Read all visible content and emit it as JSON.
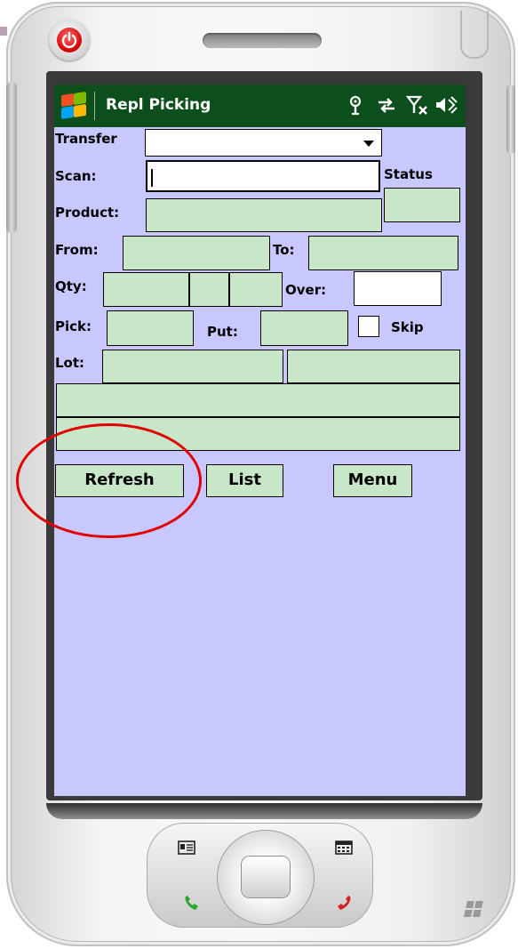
{
  "window": {
    "title": "Repl Picking",
    "tray_icons": [
      "antenna-icon",
      "sync-arrows-icon",
      "signal-off-icon",
      "speaker-icon"
    ]
  },
  "form": {
    "transfer_label": "Transfer",
    "transfer_value": "",
    "scan_label": "Scan:",
    "scan_value": "",
    "status_label": "Status",
    "product_label": "Product:",
    "from_label": "From:",
    "to_label": "To:",
    "qty_label": "Qty:",
    "over_label": "Over:",
    "pick_label": "Pick:",
    "put_label": "Put:",
    "skip_label": "Skip",
    "lot_label": "Lot:"
  },
  "buttons": {
    "refresh": "Refresh",
    "list": "List",
    "menu": "Menu"
  },
  "colors": {
    "screen_bg": "#c8c8ff",
    "titlebar_bg": "#0d4e1d",
    "field_bg": "#c8e6c8",
    "highlight_circle": "#e00000"
  }
}
